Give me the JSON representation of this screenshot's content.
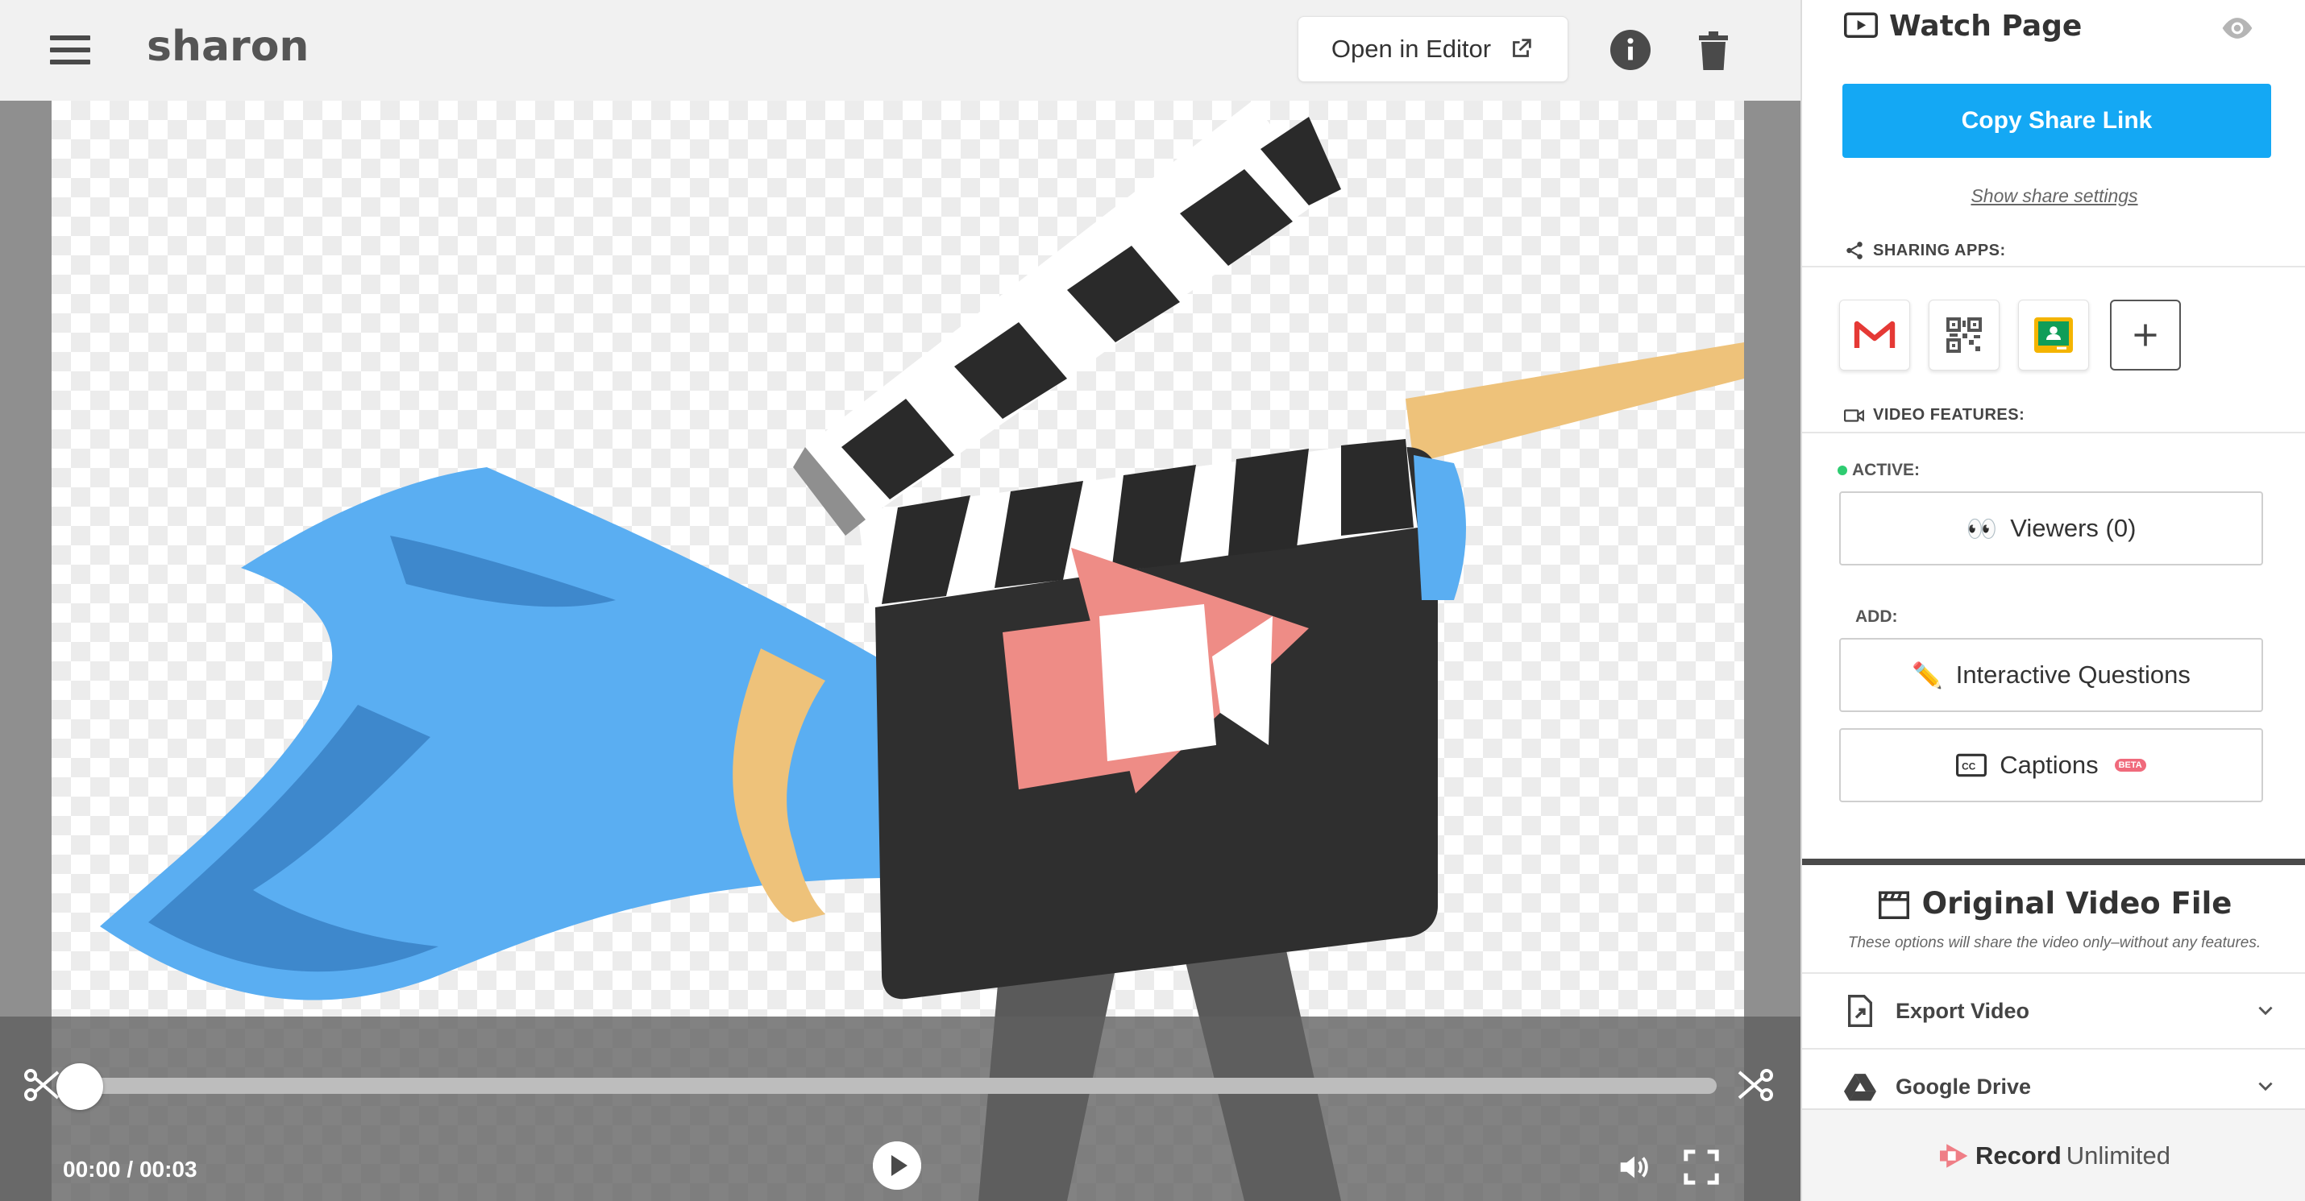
{
  "topbar": {
    "title": "sharon",
    "open_editor_label": "Open in Editor"
  },
  "player": {
    "time_display": "00:00 / 00:03",
    "progress": 0
  },
  "sidebar": {
    "watch_page_title": "Watch Page",
    "copy_share_link_label": "Copy Share Link",
    "show_share_settings_label": "Show share settings",
    "sharing_apps_heading": "SHARING APPS:",
    "sharing_apps": [
      "gmail-icon",
      "qr-code-icon",
      "google-classroom-icon",
      "plus-icon"
    ],
    "video_features_heading": "VIDEO FEATURES:",
    "active_label": "ACTIVE:",
    "viewers_label": "Viewers (0)",
    "viewers_emoji": "👀",
    "add_label": "ADD:",
    "interactive_questions_label": "Interactive Questions",
    "interactive_questions_emoji": "✏️",
    "captions_label": "Captions",
    "captions_badge": "BETA",
    "original_video_title": "Original Video File",
    "original_video_subtitle": "These options will share the video only–without any features.",
    "export_video_label": "Export Video",
    "google_drive_label": "Google Drive",
    "brand_bold": "Record",
    "brand_light": "Unlimited",
    "accent_color": "#14a8f4"
  }
}
